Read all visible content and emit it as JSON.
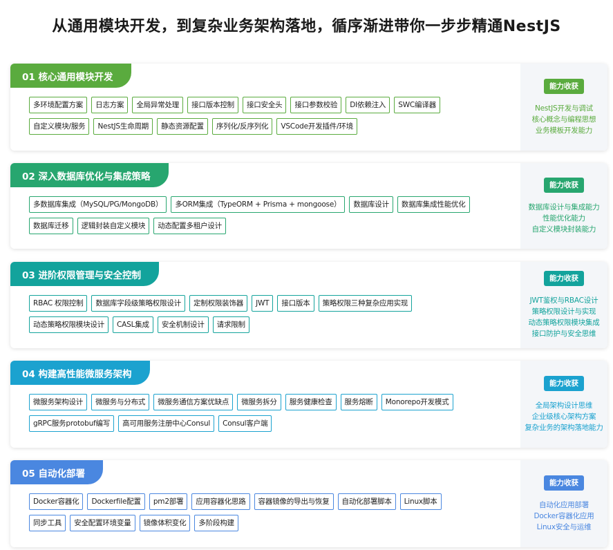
{
  "page": {
    "title": "从通用模块开发，到复杂业务架构落地，循序渐进带你一步步精通NestJS"
  },
  "sections": [
    {
      "title": "01 核心通用模块开发",
      "color": "#5aab3e",
      "tag_rows": [
        [
          "多环境配置方案",
          "日志方案",
          "全局异常处理",
          "接口版本控制",
          "接口安全头",
          "接口参数校验",
          "DI依赖注入",
          "SWC编译器"
        ],
        [
          "自定义模块/服务",
          "NestJS生命周期",
          "静态资源配置",
          "序列化/反序列化",
          "VSCode开发插件/环境"
        ]
      ],
      "badge": "能力收获",
      "abilities": [
        "NestJS开发与调试",
        "核心概念与编程思想",
        "业务模板开发能力"
      ]
    },
    {
      "title": "02 深入数据库优化与集成策略",
      "color": "#27a66f",
      "tag_rows": [
        [
          "多数据库集成（MySQL/PG/MongoDB）",
          "多ORM集成（TypeORM + Prisma + mongoose）",
          "数据库设计",
          "数据库集成性能优化"
        ],
        [
          "数据库迁移",
          "逻辑封装自定义模块",
          "动态配置多租户设计"
        ]
      ],
      "badge": "能力收获",
      "abilities": [
        "数据库设计与集成能力",
        "性能优化能力",
        "自定义模块封装能力"
      ]
    },
    {
      "title": "03 进阶权限管理与安全控制",
      "color": "#13a39c",
      "tag_rows": [
        [
          "RBAC 权限控制",
          "数据库字段级策略权限设计",
          "定制权限装饰器",
          "JWT",
          "接口版本",
          "策略权限三种复杂应用实现"
        ],
        [
          "动态策略权限模块设计",
          "CASL集成",
          "安全机制设计",
          "请求限制"
        ]
      ],
      "badge": "能力收获",
      "abilities": [
        "JWT鉴权与RBAC设计",
        "策略权限设计与实现",
        "动态策略权限模块集成",
        "接口防护与安全思维"
      ]
    },
    {
      "title": "04 构建高性能微服务架构",
      "color": "#1ba2cf",
      "tag_rows": [
        [
          "微服务架构设计",
          "微服务与分布式",
          "微服务通信方案优缺点",
          "微服务拆分",
          "服务健康检查",
          "服务熔断",
          "Monorepo开发模式"
        ],
        [
          "gRPC服务protobuf编写",
          "高可用服务注册中心Consul",
          "Consul客户端"
        ]
      ],
      "badge": "能力收获",
      "abilities": [
        "全局架构设计思维",
        "企业级核心架构方案",
        "复杂业务的架构落地能力"
      ]
    },
    {
      "title": "05 自动化部署",
      "color": "#4a87e0",
      "tag_rows": [
        [
          "Docker容器化",
          "Dockerfile配置",
          "pm2部署",
          "应用容器化思路",
          "容器镜像的导出与恢复",
          "自动化部署脚本",
          "Linux脚本"
        ],
        [
          "同步工具",
          "安全配置环境变量",
          "镜像体积变化",
          "多阶段构建"
        ]
      ],
      "badge": "能力收获",
      "abilities": [
        "自动化应用部署",
        "Docker容器化应用",
        "Linux安全与运维"
      ]
    }
  ]
}
